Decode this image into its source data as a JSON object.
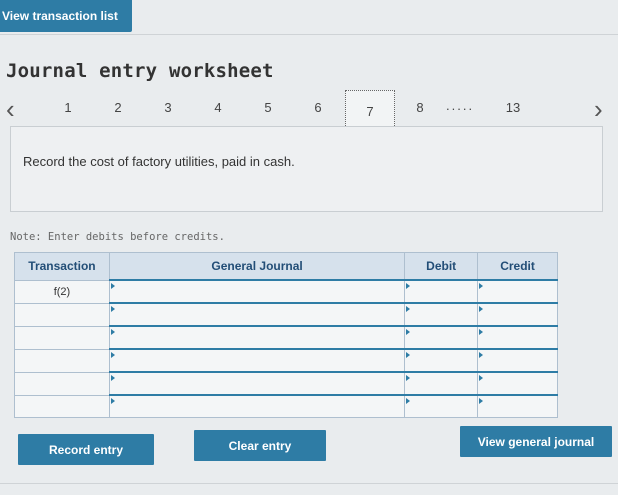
{
  "header": {
    "view_transaction_list": "View transaction list"
  },
  "worksheet": {
    "title": "Journal entry worksheet"
  },
  "pagination": {
    "prev": "‹",
    "next": "›",
    "pages": [
      "1",
      "2",
      "3",
      "4",
      "5",
      "6",
      "7",
      "8"
    ],
    "active": "7",
    "ellipsis": ".....",
    "last": "13"
  },
  "instruction": "Record the cost of factory utilities, paid in cash.",
  "note": "Note: Enter debits before credits.",
  "journal": {
    "headers": {
      "transaction": "Transaction",
      "general_journal": "General Journal",
      "debit": "Debit",
      "credit": "Credit"
    },
    "rows": [
      {
        "transaction": "f(2)"
      },
      {
        "transaction": ""
      },
      {
        "transaction": ""
      },
      {
        "transaction": ""
      },
      {
        "transaction": ""
      },
      {
        "transaction": ""
      }
    ]
  },
  "buttons": {
    "record_entry": "Record entry",
    "clear_entry": "Clear entry",
    "view_general_journal": "View general journal"
  },
  "colors": {
    "accent": "#2e7ca5",
    "header_bg": "#d6e1ec",
    "header_text": "#234e77"
  }
}
